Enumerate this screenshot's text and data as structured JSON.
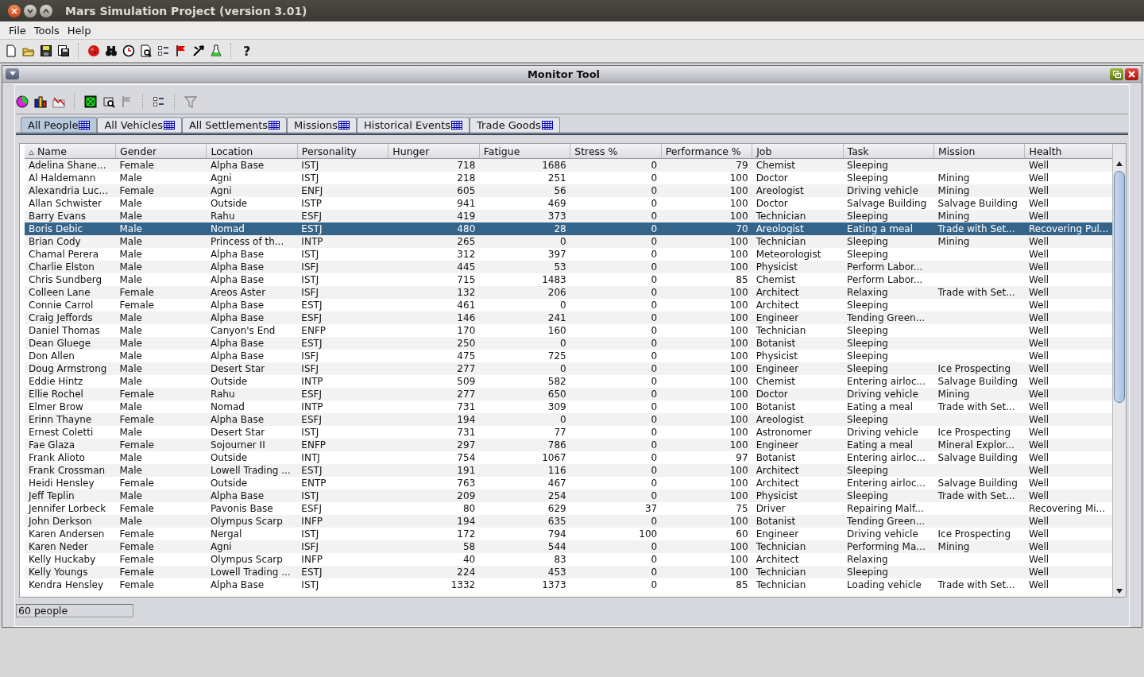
{
  "window": {
    "title": "Mars Simulation Project (version 3.01)"
  },
  "menu": [
    "File",
    "Tools",
    "Help"
  ],
  "toolbar": {
    "help_label": "?"
  },
  "monitor": {
    "title": "Monitor Tool",
    "tabs": [
      {
        "label": "All People",
        "selected": true
      },
      {
        "label": "All Vehicles",
        "selected": false
      },
      {
        "label": "All Settlements",
        "selected": false
      },
      {
        "label": "Missions",
        "selected": false
      },
      {
        "label": "Historical Events",
        "selected": false
      },
      {
        "label": "Trade Goods",
        "selected": false
      }
    ],
    "table": {
      "columns": [
        {
          "label": "Name",
          "kind": "text",
          "sorted": true
        },
        {
          "label": "Gender",
          "kind": "text",
          "sorted": false
        },
        {
          "label": "Location",
          "kind": "text",
          "sorted": false
        },
        {
          "label": "Personality",
          "kind": "text",
          "sorted": false
        },
        {
          "label": "Hunger",
          "kind": "number",
          "sorted": false
        },
        {
          "label": "Fatigue",
          "kind": "number",
          "sorted": false
        },
        {
          "label": "Stress %",
          "kind": "number",
          "sorted": false
        },
        {
          "label": "Performance %",
          "kind": "number",
          "sorted": false
        },
        {
          "label": "Job",
          "kind": "text",
          "sorted": false
        },
        {
          "label": "Task",
          "kind": "text",
          "sorted": false
        },
        {
          "label": "Mission",
          "kind": "text",
          "sorted": false
        },
        {
          "label": "Health",
          "kind": "text",
          "sorted": false
        }
      ],
      "rows": [
        {
          "selected": false,
          "cells": [
            "Adelina Shane...",
            "Female",
            "Alpha Base",
            "ISTJ",
            "718",
            "1686",
            "0",
            "79",
            "Chemist",
            "Sleeping",
            null,
            "Well"
          ]
        },
        {
          "selected": false,
          "cells": [
            "Al Haldemann",
            "Male",
            "Agni",
            "ISTJ",
            "218",
            "251",
            "0",
            "100",
            "Doctor",
            "Sleeping",
            "Mining",
            "Well"
          ]
        },
        {
          "selected": false,
          "cells": [
            "Alexandria Luc...",
            "Female",
            "Agni",
            "ENFJ",
            "605",
            "56",
            "0",
            "100",
            "Areologist",
            "Driving vehicle",
            "Mining",
            "Well"
          ]
        },
        {
          "selected": false,
          "cells": [
            "Allan Schwister",
            "Male",
            "Outside",
            "ISTP",
            "941",
            "469",
            "0",
            "100",
            "Doctor",
            "Salvage Building",
            "Salvage Building",
            "Well"
          ]
        },
        {
          "selected": false,
          "cells": [
            "Barry Evans",
            "Male",
            "Rahu",
            "ESFJ",
            "419",
            "373",
            "0",
            "100",
            "Technician",
            "Sleeping",
            "Mining",
            "Well"
          ]
        },
        {
          "selected": true,
          "cells": [
            "Boris Debic",
            "Male",
            "Nomad",
            "ESTJ",
            "480",
            "28",
            "0",
            "70",
            "Areologist",
            "Eating a meal",
            "Trade with Set...",
            "Recovering Pul..."
          ]
        },
        {
          "selected": false,
          "cells": [
            "Brian Cody",
            "Male",
            "Princess of th...",
            "INTP",
            "265",
            "0",
            "0",
            "100",
            "Technician",
            "Sleeping",
            "Mining",
            "Well"
          ]
        },
        {
          "selected": false,
          "cells": [
            "Chamal Perera",
            "Male",
            "Alpha Base",
            "ISTJ",
            "312",
            "397",
            "0",
            "100",
            "Meteorologist",
            "Sleeping",
            null,
            "Well"
          ]
        },
        {
          "selected": false,
          "cells": [
            "Charlie Elston",
            "Male",
            "Alpha Base",
            "ISFJ",
            "445",
            "53",
            "0",
            "100",
            "Physicist",
            "Perform Labor...",
            null,
            "Well"
          ]
        },
        {
          "selected": false,
          "cells": [
            "Chris Sundberg",
            "Male",
            "Alpha Base",
            "ISTJ",
            "715",
            "1483",
            "0",
            "85",
            "Chemist",
            "Perform Labor...",
            null,
            "Well"
          ]
        },
        {
          "selected": false,
          "cells": [
            "Colleen Lane",
            "Female",
            "Areos Aster",
            "ISFJ",
            "132",
            "206",
            "0",
            "100",
            "Architect",
            "Relaxing",
            "Trade with Set...",
            "Well"
          ]
        },
        {
          "selected": false,
          "cells": [
            "Connie Carrol",
            "Female",
            "Alpha Base",
            "ESTJ",
            "461",
            "0",
            "0",
            "100",
            "Architect",
            "Sleeping",
            null,
            "Well"
          ]
        },
        {
          "selected": false,
          "cells": [
            "Craig Jeffords",
            "Male",
            "Alpha Base",
            "ESFJ",
            "146",
            "241",
            "0",
            "100",
            "Engineer",
            "Tending Green...",
            null,
            "Well"
          ]
        },
        {
          "selected": false,
          "cells": [
            "Daniel Thomas",
            "Male",
            "Canyon's End",
            "ENFP",
            "170",
            "160",
            "0",
            "100",
            "Technician",
            "Sleeping",
            null,
            "Well"
          ]
        },
        {
          "selected": false,
          "cells": [
            "Dean Gluege",
            "Male",
            "Alpha Base",
            "ESTJ",
            "250",
            "0",
            "0",
            "100",
            "Botanist",
            "Sleeping",
            null,
            "Well"
          ]
        },
        {
          "selected": false,
          "cells": [
            "Don Allen",
            "Male",
            "Alpha Base",
            "ISFJ",
            "475",
            "725",
            "0",
            "100",
            "Physicist",
            "Sleeping",
            null,
            "Well"
          ]
        },
        {
          "selected": false,
          "cells": [
            "Doug Armstrong",
            "Male",
            "Desert Star",
            "ISFJ",
            "277",
            "0",
            "0",
            "100",
            "Engineer",
            "Sleeping",
            "Ice Prospecting",
            "Well"
          ]
        },
        {
          "selected": false,
          "cells": [
            "Eddie Hintz",
            "Male",
            "Outside",
            "INTP",
            "509",
            "582",
            "0",
            "100",
            "Chemist",
            "Entering airloc...",
            "Salvage Building",
            "Well"
          ]
        },
        {
          "selected": false,
          "cells": [
            "Ellie Rochel",
            "Female",
            "Rahu",
            "ESFJ",
            "277",
            "650",
            "0",
            "100",
            "Doctor",
            "Driving vehicle",
            "Mining",
            "Well"
          ]
        },
        {
          "selected": false,
          "cells": [
            "Elmer Brow",
            "Male",
            "Nomad",
            "INTP",
            "731",
            "309",
            "0",
            "100",
            "Botanist",
            "Eating a meal",
            "Trade with Set...",
            "Well"
          ]
        },
        {
          "selected": false,
          "cells": [
            "Erinn Thayne",
            "Female",
            "Alpha Base",
            "ESFJ",
            "194",
            "0",
            "0",
            "100",
            "Areologist",
            "Sleeping",
            null,
            "Well"
          ]
        },
        {
          "selected": false,
          "cells": [
            "Ernest Coletti",
            "Male",
            "Desert Star",
            "ISTJ",
            "731",
            "77",
            "0",
            "100",
            "Astronomer",
            "Driving vehicle",
            "Ice Prospecting",
            "Well"
          ]
        },
        {
          "selected": false,
          "cells": [
            "Fae Glaza",
            "Female",
            "Sojourner II",
            "ENFP",
            "297",
            "786",
            "0",
            "100",
            "Engineer",
            "Eating a meal",
            "Mineral Explor...",
            "Well"
          ]
        },
        {
          "selected": false,
          "cells": [
            "Frank Alioto",
            "Male",
            "Outside",
            "INTJ",
            "754",
            "1067",
            "0",
            "97",
            "Botanist",
            "Entering airloc...",
            "Salvage Building",
            "Well"
          ]
        },
        {
          "selected": false,
          "cells": [
            "Frank Crossman",
            "Male",
            "Lowell Trading ...",
            "ESTJ",
            "191",
            "116",
            "0",
            "100",
            "Architect",
            "Sleeping",
            null,
            "Well"
          ]
        },
        {
          "selected": false,
          "cells": [
            "Heidi Hensley",
            "Female",
            "Outside",
            "ENTP",
            "763",
            "467",
            "0",
            "100",
            "Architect",
            "Entering airloc...",
            "Salvage Building",
            "Well"
          ]
        },
        {
          "selected": false,
          "cells": [
            "Jeff Teplin",
            "Male",
            "Alpha Base",
            "ISTJ",
            "209",
            "254",
            "0",
            "100",
            "Physicist",
            "Sleeping",
            "Trade with Set...",
            "Well"
          ]
        },
        {
          "selected": false,
          "cells": [
            "Jennifer Lorbeck",
            "Female",
            "Pavonis Base",
            "ESFJ",
            "80",
            "629",
            "37",
            "75",
            "Driver",
            "Repairing Malf...",
            null,
            "Recovering Mi..."
          ]
        },
        {
          "selected": false,
          "cells": [
            "John Derkson",
            "Male",
            "Olympus Scarp",
            "INFP",
            "194",
            "635",
            "0",
            "100",
            "Botanist",
            "Tending Green...",
            null,
            "Well"
          ]
        },
        {
          "selected": false,
          "cells": [
            "Karen Andersen",
            "Female",
            "Nergal",
            "ISTJ",
            "172",
            "794",
            "100",
            "60",
            "Engineer",
            "Driving vehicle",
            "Ice Prospecting",
            "Well"
          ]
        },
        {
          "selected": false,
          "cells": [
            "Karen Neder",
            "Female",
            "Agni",
            "ISFJ",
            "58",
            "544",
            "0",
            "100",
            "Technician",
            "Performing Ma...",
            "Mining",
            "Well"
          ]
        },
        {
          "selected": false,
          "cells": [
            "Kelly Huckaby",
            "Female",
            "Olympus Scarp",
            "INFP",
            "40",
            "83",
            "0",
            "100",
            "Architect",
            "Relaxing",
            null,
            "Well"
          ]
        },
        {
          "selected": false,
          "cells": [
            "Kelly Youngs",
            "Female",
            "Lowell Trading ...",
            "ESTJ",
            "224",
            "453",
            "0",
            "100",
            "Technician",
            "Sleeping",
            null,
            "Well"
          ]
        },
        {
          "selected": false,
          "cells": [
            "Kendra Hensley",
            "Female",
            "Alpha Base",
            "ISTJ",
            "1332",
            "1373",
            "0",
            "85",
            "Technician",
            "Loading vehicle",
            "Trade with Set...",
            "Well"
          ]
        }
      ]
    },
    "status": "60 people"
  }
}
